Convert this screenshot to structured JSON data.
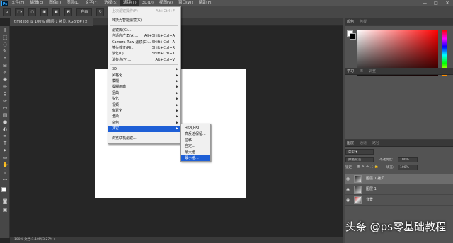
{
  "menubar": {
    "logo": "Ps",
    "items": [
      "文件(F)",
      "编辑(E)",
      "图像(I)",
      "图层(L)",
      "文字(Y)",
      "选择(S)",
      "滤镜(T)",
      "3D(D)",
      "视图(V)",
      "窗口(W)",
      "帮助(H)"
    ],
    "active_index": 6
  },
  "window_controls": {
    "minimize": "—",
    "maximize": "□",
    "close": "✕"
  },
  "options_bar": {
    "mode_label": "自由",
    "extra": "↻"
  },
  "document_tab": {
    "label": "timg.jpg @ 100% (图层 1 拷贝, RGB/8#) ×"
  },
  "status_bar": {
    "text": "100%    文档:1.10M/3.27M    >"
  },
  "filter_menu": {
    "items": [
      {
        "label": "上次滤镜操作(F)",
        "shortcut": "Alt+Ctrl+F",
        "disabled": true,
        "arrow": false
      },
      {
        "sep": true
      },
      {
        "label": "转换为智能滤镜(S)",
        "shortcut": "",
        "disabled": false,
        "arrow": false
      },
      {
        "sep": true
      },
      {
        "label": "滤镜库(G)...",
        "shortcut": "",
        "disabled": false,
        "arrow": false
      },
      {
        "label": "自适应广角(A)...",
        "shortcut": "Alt+Shift+Ctrl+A",
        "disabled": false,
        "arrow": false
      },
      {
        "label": "Camera Raw 滤镜(C)...",
        "shortcut": "Shift+Ctrl+A",
        "disabled": false,
        "arrow": false
      },
      {
        "label": "镜头校正(R)...",
        "shortcut": "Shift+Ctrl+R",
        "disabled": false,
        "arrow": false
      },
      {
        "label": "液化(L)...",
        "shortcut": "Shift+Ctrl+X",
        "disabled": false,
        "arrow": false
      },
      {
        "label": "消失点(V)...",
        "shortcut": "Alt+Ctrl+V",
        "disabled": false,
        "arrow": false
      },
      {
        "sep": true
      },
      {
        "label": "3D",
        "shortcut": "",
        "disabled": false,
        "arrow": true
      },
      {
        "label": "风格化",
        "shortcut": "",
        "disabled": false,
        "arrow": true
      },
      {
        "label": "模糊",
        "shortcut": "",
        "disabled": false,
        "arrow": true
      },
      {
        "label": "模糊画廊",
        "shortcut": "",
        "disabled": false,
        "arrow": true
      },
      {
        "label": "扭曲",
        "shortcut": "",
        "disabled": false,
        "arrow": true
      },
      {
        "label": "锐化",
        "shortcut": "",
        "disabled": false,
        "arrow": true
      },
      {
        "label": "视频",
        "shortcut": "",
        "disabled": false,
        "arrow": true
      },
      {
        "label": "像素化",
        "shortcut": "",
        "disabled": false,
        "arrow": true
      },
      {
        "label": "渲染",
        "shortcut": "",
        "disabled": false,
        "arrow": true
      },
      {
        "label": "杂色",
        "shortcut": "",
        "disabled": false,
        "arrow": true
      },
      {
        "label": "其它",
        "shortcut": "",
        "disabled": false,
        "arrow": true,
        "highlight": true
      },
      {
        "sep": true
      },
      {
        "label": "浏览联机滤镜...",
        "shortcut": "",
        "disabled": false,
        "arrow": false
      }
    ]
  },
  "other_submenu": {
    "items": [
      {
        "label": "HSB/HSL"
      },
      {
        "label": "高反差保留..."
      },
      {
        "label": "位移..."
      },
      {
        "label": "自定..."
      },
      {
        "label": "最大值..."
      },
      {
        "label": "最小值...",
        "highlight": true
      }
    ]
  },
  "color_panel": {
    "tabs": [
      "颜色",
      "色板"
    ],
    "foreground": "#ffffff",
    "background": "#000000"
  },
  "learn_panel": {
    "tabs": [
      "学习",
      "库",
      "调整"
    ]
  },
  "layers_panel": {
    "tabs": [
      "图层",
      "通道",
      "路径"
    ],
    "kind_filter": "类型",
    "blend_mode": "颜色减淡",
    "opacity_label": "不透明度:",
    "opacity_value": "100%",
    "lock_label": "锁定:",
    "fill_label": "填充:",
    "fill_value": "100%",
    "layers": [
      {
        "name": "图层 1 拷贝",
        "selected": true
      },
      {
        "name": "图层 1",
        "selected": false
      },
      {
        "name": "背景",
        "selected": false
      }
    ]
  },
  "watermark": "头条 @ps零基础教程"
}
